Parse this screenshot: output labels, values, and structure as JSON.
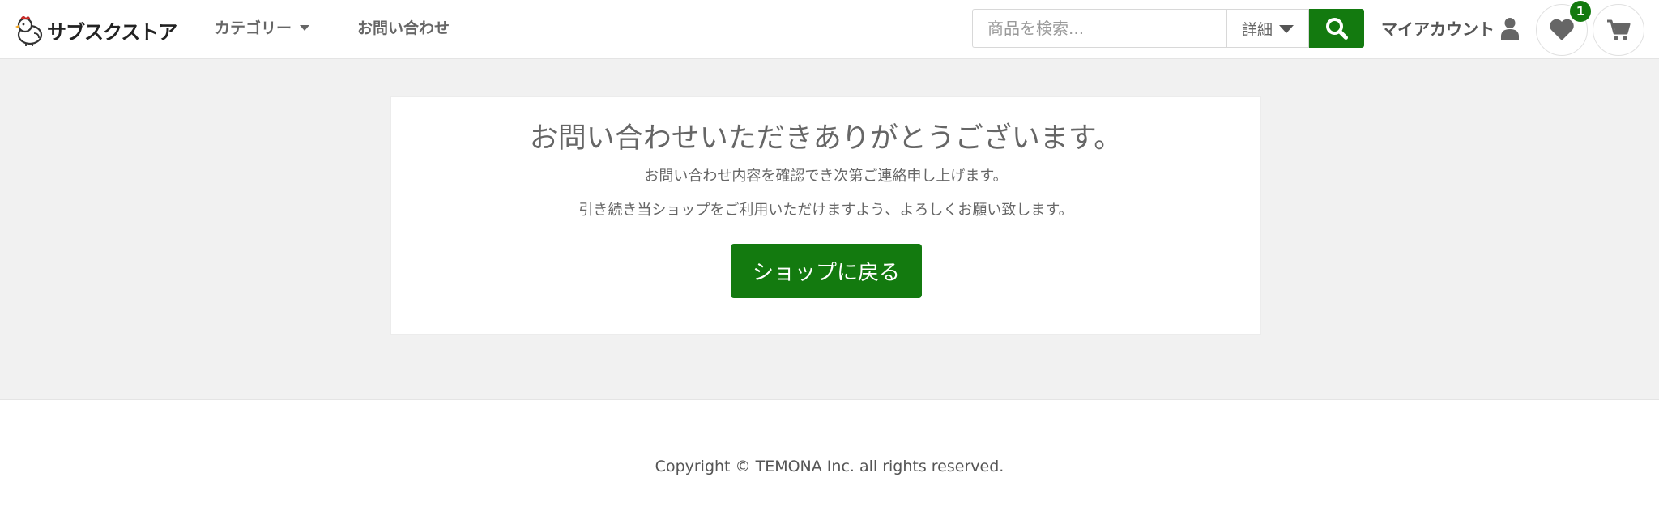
{
  "header": {
    "logo_text": "サブスクストア",
    "nav_category": "カテゴリー",
    "nav_contact": "お問い合わせ",
    "search_placeholder": "商品を検索...",
    "search_detail": "詳細",
    "account_label": "マイアカウント",
    "favorites_count": "1"
  },
  "main": {
    "title": "お問い合わせいただきありがとうございます。",
    "line1": "お問い合わせ内容を確認でき次第ご連絡申し上げます。",
    "line2": "引き続き当ショップをご利用いただけますよう、よろしくお願い致します。",
    "back_button": "ショップに戻る"
  },
  "footer": {
    "copyright": "Copyright © TEMONA Inc. all rights reserved."
  },
  "colors": {
    "accent": "#137a0f",
    "background": "#f1f1f1"
  },
  "icons": [
    "chicken-logo-icon",
    "search-icon",
    "user-icon",
    "heart-icon",
    "cart-icon"
  ]
}
